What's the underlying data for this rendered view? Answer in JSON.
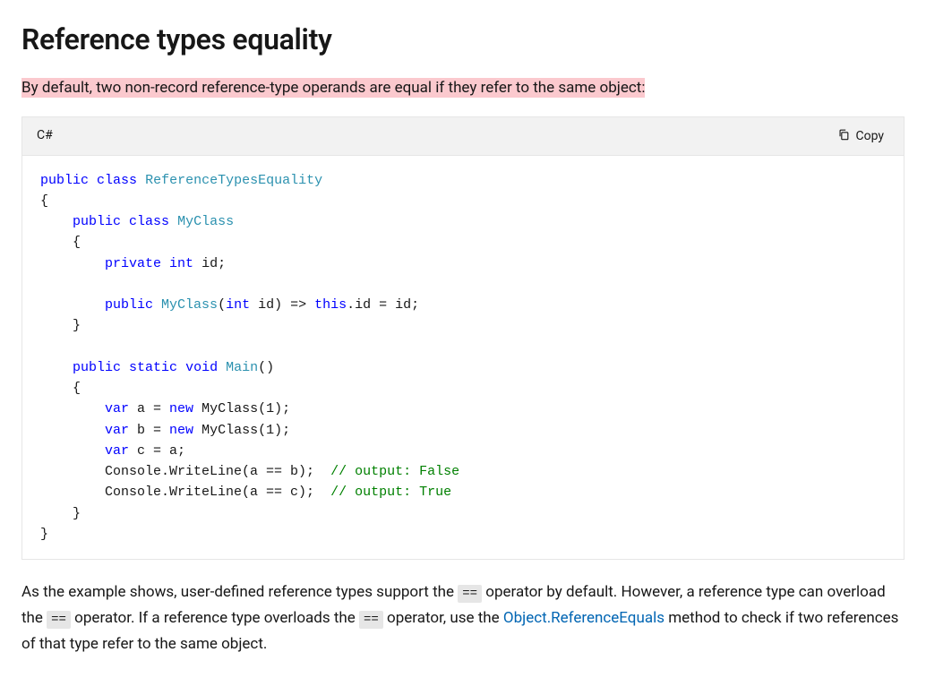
{
  "heading": "Reference types equality",
  "intro": "By default, two non-record reference-type operands are equal if they refer to the same object:",
  "code": {
    "language": "C#",
    "copy_label": "Copy",
    "tokens": [
      {
        "t": "public",
        "c": "kw"
      },
      {
        "t": " "
      },
      {
        "t": "class",
        "c": "kw"
      },
      {
        "t": " "
      },
      {
        "t": "ReferenceTypesEquality",
        "c": "type"
      },
      {
        "nl": 1
      },
      {
        "t": "{"
      },
      {
        "nl": 1
      },
      {
        "t": "    "
      },
      {
        "t": "public",
        "c": "kw"
      },
      {
        "t": " "
      },
      {
        "t": "class",
        "c": "kw"
      },
      {
        "t": " "
      },
      {
        "t": "MyClass",
        "c": "type"
      },
      {
        "nl": 1
      },
      {
        "t": "    {"
      },
      {
        "nl": 1
      },
      {
        "t": "        "
      },
      {
        "t": "private",
        "c": "kw"
      },
      {
        "t": " "
      },
      {
        "t": "int",
        "c": "kw"
      },
      {
        "t": " id;"
      },
      {
        "nl": 1
      },
      {
        "nl": 1
      },
      {
        "t": "        "
      },
      {
        "t": "public",
        "c": "kw"
      },
      {
        "t": " "
      },
      {
        "t": "MyClass",
        "c": "type"
      },
      {
        "t": "("
      },
      {
        "t": "int",
        "c": "kw"
      },
      {
        "t": " id) => "
      },
      {
        "t": "this",
        "c": "kw"
      },
      {
        "t": ".id = id;"
      },
      {
        "nl": 1
      },
      {
        "t": "    }"
      },
      {
        "nl": 1
      },
      {
        "nl": 1
      },
      {
        "t": "    "
      },
      {
        "t": "public",
        "c": "kw"
      },
      {
        "t": " "
      },
      {
        "t": "static",
        "c": "kw"
      },
      {
        "t": " "
      },
      {
        "t": "void",
        "c": "kw"
      },
      {
        "t": " "
      },
      {
        "t": "Main",
        "c": "type"
      },
      {
        "t": "()"
      },
      {
        "nl": 1
      },
      {
        "t": "    {"
      },
      {
        "nl": 1
      },
      {
        "t": "        "
      },
      {
        "t": "var",
        "c": "kw"
      },
      {
        "t": " a = "
      },
      {
        "t": "new",
        "c": "kw"
      },
      {
        "t": " MyClass(1);"
      },
      {
        "nl": 1
      },
      {
        "t": "        "
      },
      {
        "t": "var",
        "c": "kw"
      },
      {
        "t": " b = "
      },
      {
        "t": "new",
        "c": "kw"
      },
      {
        "t": " MyClass(1);"
      },
      {
        "nl": 1
      },
      {
        "t": "        "
      },
      {
        "t": "var",
        "c": "kw"
      },
      {
        "t": " c = a;"
      },
      {
        "nl": 1
      },
      {
        "t": "        Console.WriteLine(a == b);  "
      },
      {
        "t": "// output: False",
        "c": "cm"
      },
      {
        "nl": 1
      },
      {
        "t": "        Console.WriteLine(a == c);  "
      },
      {
        "t": "// output: True",
        "c": "cm"
      },
      {
        "nl": 1
      },
      {
        "t": "    }"
      },
      {
        "nl": 1
      },
      {
        "t": "}"
      }
    ]
  },
  "paragraph": {
    "seg1": "As the example shows, user-defined reference types support the ",
    "op1": "==",
    "seg2": " operator by default. However, a reference type can overload the ",
    "op2": "==",
    "seg3": " operator. If a reference type overloads the ",
    "op3": "==",
    "seg4": " operator, use the ",
    "link": "Object.ReferenceEquals",
    "seg5": " method to check if two references of that type refer to the same object."
  }
}
